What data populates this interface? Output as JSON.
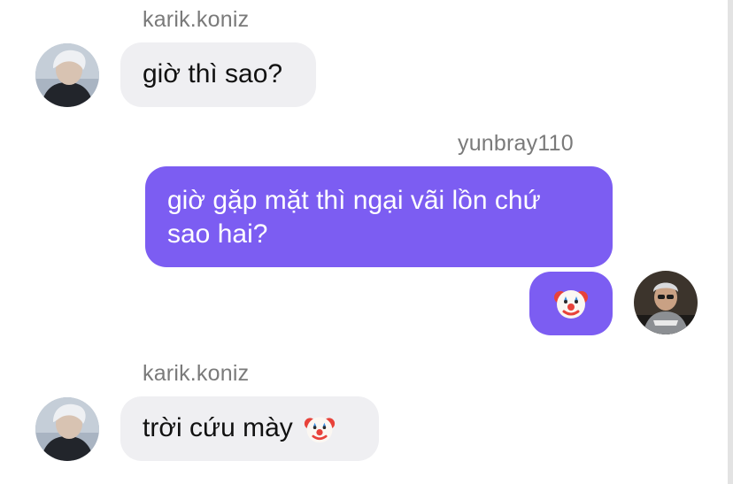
{
  "thread": {
    "messages": [
      {
        "sender": "karik.koniz",
        "direction": "incoming",
        "text": "giờ thì sao?"
      },
      {
        "sender": "yunbray110",
        "direction": "outgoing",
        "text": "giờ gặp mặt thì ngại vãi lồn chứ\nsao hai?"
      },
      {
        "sender": "yunbray110",
        "direction": "outgoing",
        "emoji": "clown-face-icon"
      },
      {
        "sender": "karik.koniz",
        "direction": "incoming",
        "text": "trời cứu mày",
        "emoji": "clown-face-icon"
      }
    ]
  },
  "colors": {
    "outgoing_bubble": "#7c5df2",
    "incoming_bubble": "#efeff2",
    "sender_name": "#7a7a7a"
  }
}
